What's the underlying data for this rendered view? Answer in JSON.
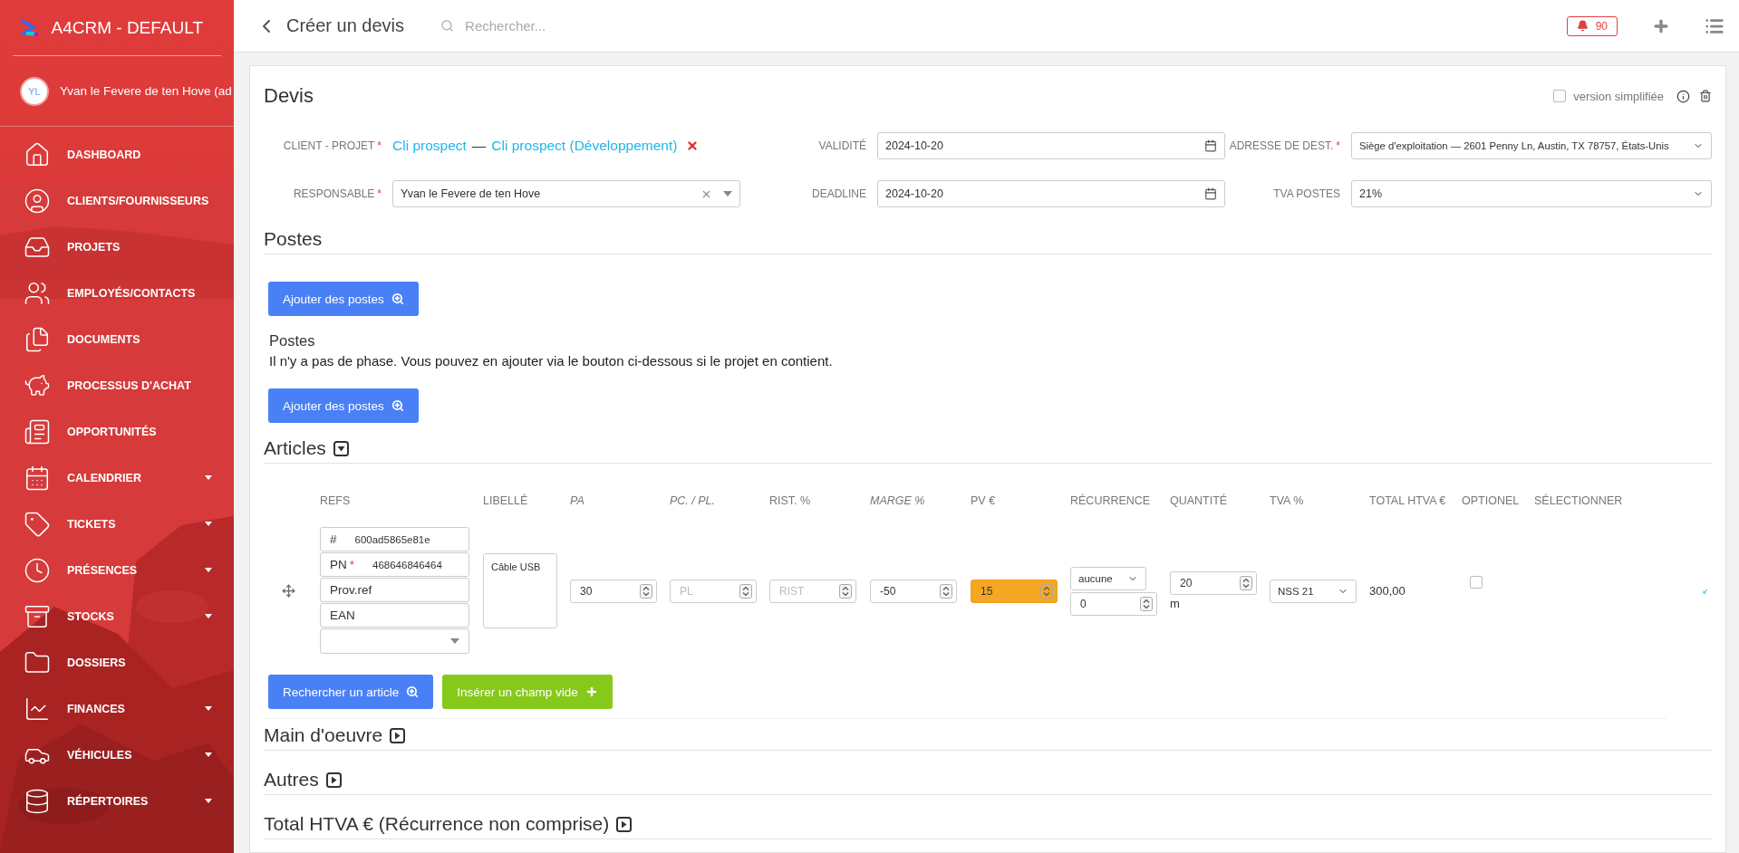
{
  "sidebar": {
    "brand": "A4CRM - DEFAULT",
    "user": {
      "initials": "YL",
      "name": "Yvan le Fevere de ten Hove (ad"
    },
    "items": [
      {
        "label": "DASHBOARD",
        "submenu": false
      },
      {
        "label": "CLIENTS/FOURNISSEURS",
        "submenu": false
      },
      {
        "label": "PROJETS",
        "submenu": false
      },
      {
        "label": "EMPLOYÉS/CONTACTS",
        "submenu": false
      },
      {
        "label": "DOCUMENTS",
        "submenu": false
      },
      {
        "label": "PROCESSUS D'ACHAT",
        "submenu": false
      },
      {
        "label": "OPPORTUNITÉS",
        "submenu": false
      },
      {
        "label": "CALENDRIER",
        "submenu": true
      },
      {
        "label": "TICKETS",
        "submenu": true
      },
      {
        "label": "PRÉSENCES",
        "submenu": true
      },
      {
        "label": "STOCKS",
        "submenu": true
      },
      {
        "label": "DOSSIERS",
        "submenu": false
      },
      {
        "label": "FINANCES",
        "submenu": true
      },
      {
        "label": "VÉHICULES",
        "submenu": true
      },
      {
        "label": "RÉPERTOIRES",
        "submenu": true
      }
    ]
  },
  "header": {
    "title": "Créer un devis",
    "search_placeholder": "Rechercher...",
    "notifications": "90"
  },
  "devis": {
    "title": "Devis",
    "simplified": {
      "label": "version simplifiée",
      "checked": false
    },
    "client": {
      "label": "CLIENT - PROJET",
      "required_mark": "*",
      "client": "Cli prospect",
      "separator": "—",
      "project": "Cli prospect (Développement)"
    },
    "validite": {
      "label": "VALIDITÉ",
      "value": "2024-10-20"
    },
    "adresse": {
      "label": "ADRESSE DE DEST.",
      "required_mark": "*",
      "value": "Siège d'exploitation — 2601 Penny Ln, Austin, TX 78757, États-Unis"
    },
    "responsable": {
      "label": "RESPONSABLE",
      "required_mark": "*",
      "value": "Yvan le Fevere de ten Hove"
    },
    "deadline": {
      "label": "DEADLINE",
      "value": "2024-10-20"
    },
    "tva": {
      "label": "TVA POSTES",
      "value": "21%"
    }
  },
  "postes": {
    "title": "Postes",
    "button": "Ajouter des postes",
    "subtitle": "Postes",
    "message": "Il n'y a pas de phase. Vous pouvez en ajouter via le bouton ci-dessous si le projet en contient.",
    "button_2": "Ajouter des postes"
  },
  "articles": {
    "title": "Articles",
    "expanded": true,
    "columns": [
      {
        "label": "REFS",
        "italic": false
      },
      {
        "label": "LIBELLÉ",
        "italic": false
      },
      {
        "label": "PA",
        "italic": true
      },
      {
        "label": "PC. / PL.",
        "italic": true
      },
      {
        "label": "RIST. %",
        "italic": false
      },
      {
        "label": "MARGE %",
        "italic": true
      },
      {
        "label": "PV €",
        "italic": false
      },
      {
        "label": "RÉCURRENCE",
        "italic": false
      },
      {
        "label": "QUANTITÉ",
        "italic": false
      },
      {
        "label": "TVA %",
        "italic": false
      },
      {
        "label": "TOTAL HTVA €",
        "italic": false
      },
      {
        "label": "OPTIONEL",
        "italic": false
      },
      {
        "label": "SÉLECTIONNER",
        "italic": false
      }
    ],
    "rows": [
      {
        "refs": {
          "hash": "#",
          "ref": "600ad5865e81e",
          "pn_label": "PN",
          "pn_mark": "*",
          "pn": "468646846464",
          "prov_ref": {
            "placeholder": "Prov.ref"
          },
          "ean": {
            "placeholder": "EAN"
          }
        },
        "libelle": "Câble USB",
        "pa": {
          "value": "30",
          "highlighted": false
        },
        "pc": {
          "placeholder": "PL",
          "highlighted": false
        },
        "rist": {
          "placeholder": "RIST",
          "highlighted": false
        },
        "marge": {
          "value": "-50",
          "highlighted": false
        },
        "pv": {
          "value": "15",
          "highlighted": true
        },
        "recurrence": {
          "value": "aucune",
          "count": "0"
        },
        "quantite": {
          "value": "20",
          "unit": "m"
        },
        "tva": "NSS 21",
        "total": "300,00",
        "optional": false
      }
    ],
    "search_button": "Rechercher un article",
    "insert_button": "Insérer un champ vide"
  },
  "sections": [
    {
      "title": "Main d'oeuvre",
      "expanded": false
    },
    {
      "title": "Autres",
      "expanded": false
    },
    {
      "title": "Total HTVA € (Récurrence non comprise)",
      "expanded": false
    }
  ]
}
